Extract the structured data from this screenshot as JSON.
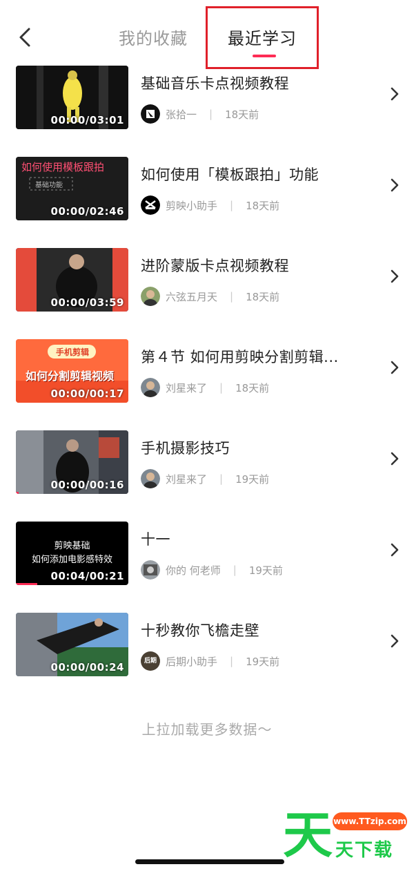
{
  "header": {
    "tab_favorites": "我的收藏",
    "tab_recent": "最近学习",
    "active_tab": "最近学习",
    "highlight_color": "#e0202a",
    "accent_color": "#fe2c55"
  },
  "items": [
    {
      "title": "基础音乐卡点视频教程",
      "time": "00:00/03:01",
      "author": "张拾一",
      "ago": "18天前"
    },
    {
      "title": "如何使用「模板跟拍」功能",
      "time": "00:00/02:46",
      "author": "剪映小助手",
      "ago": "18天前",
      "thumb_title": "如何使用模板跟拍",
      "thumb_sub": "基础功能"
    },
    {
      "title": "进阶蒙版卡点视频教程",
      "time": "00:00/03:59",
      "author": "六弦五月天",
      "ago": "18天前"
    },
    {
      "title": "第４节  如何用剪映分割剪辑...",
      "time": "00:00/00:17",
      "author": "刘星来了",
      "ago": "18天前",
      "thumb_tag": "手机剪辑",
      "thumb_title": "如何分割剪辑视频"
    },
    {
      "title": "手机摄影技巧",
      "time": "00:00/00:16",
      "author": "刘星来了",
      "ago": "19天前"
    },
    {
      "title": "十一",
      "time": "00:04/00:21",
      "author": "你的 何老师",
      "ago": "19天前",
      "thumb_line1": "剪映基础",
      "thumb_line2": "如何添加电影感特效",
      "progress": 0.19
    },
    {
      "title": "十秒教你飞檐走壁",
      "time": "00:00/00:24",
      "author": "后期小助手",
      "ago": "19天前",
      "avatar_text": "后期"
    }
  ],
  "load_more": "上拉加载更多数据～",
  "watermark": {
    "big": "天",
    "url": "www.TTzip.com",
    "text": "天下载"
  }
}
